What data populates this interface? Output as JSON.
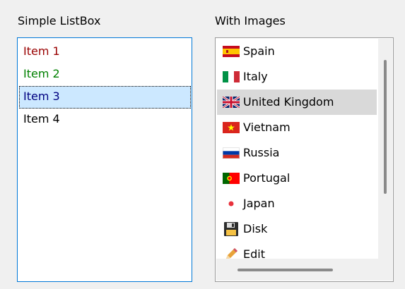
{
  "simple_listbox": {
    "label": "Simple ListBox",
    "items": [
      {
        "text": "Item 1",
        "color": "#990000"
      },
      {
        "text": "Item 2",
        "color": "#008000"
      },
      {
        "text": "Item 3",
        "color": "#000080",
        "selected": true
      },
      {
        "text": "Item 4",
        "color": "#000000"
      }
    ]
  },
  "image_listbox": {
    "label": "With Images",
    "items": [
      {
        "text": "Spain",
        "icon": "spain-flag-icon"
      },
      {
        "text": "Italy",
        "icon": "italy-flag-icon"
      },
      {
        "text": "United Kingdom",
        "icon": "uk-flag-icon",
        "highlighted": true
      },
      {
        "text": "Vietnam",
        "icon": "vietnam-flag-icon"
      },
      {
        "text": "Russia",
        "icon": "russia-flag-icon"
      },
      {
        "text": "Portugal",
        "icon": "portugal-flag-icon"
      },
      {
        "text": "Japan",
        "icon": "japan-flag-icon"
      },
      {
        "text": "Disk",
        "icon": "floppy-disk-icon"
      },
      {
        "text": "Edit",
        "icon": "pencil-icon"
      }
    ]
  },
  "colors": {
    "focus_border": "#0078d7",
    "selection_bg": "#cce8ff",
    "highlight_bg": "#d9d9d9"
  }
}
